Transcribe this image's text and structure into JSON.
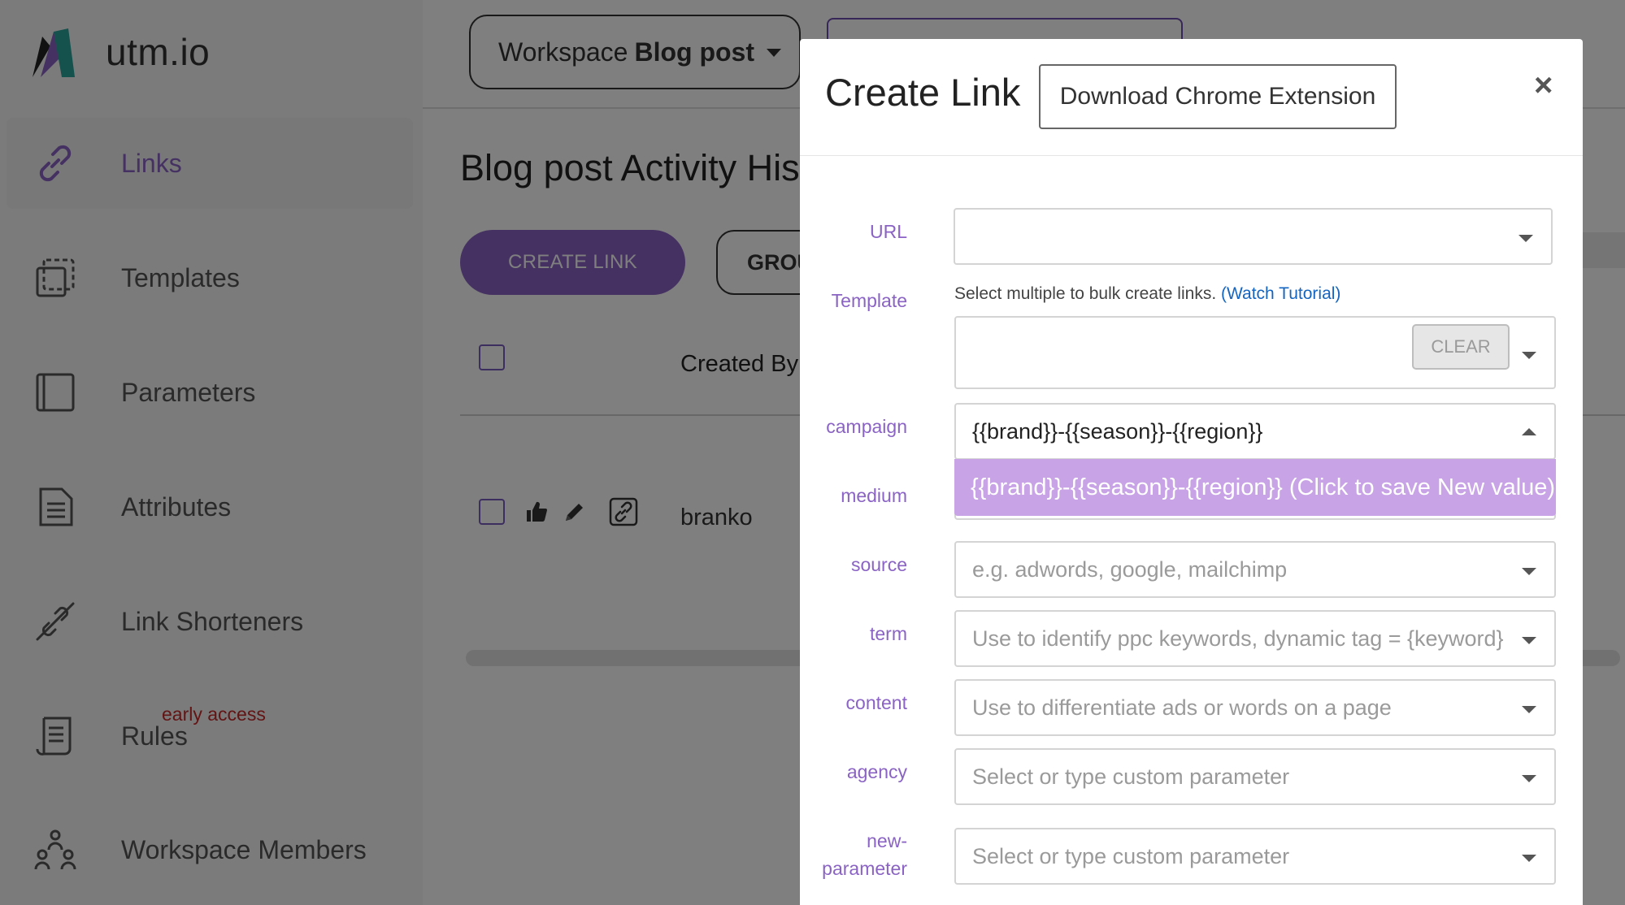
{
  "app": {
    "name": "utm.io"
  },
  "sidebar": {
    "items": [
      {
        "label": "Links",
        "icon": "link-icon",
        "active": true
      },
      {
        "label": "Templates",
        "icon": "templates-icon",
        "active": false
      },
      {
        "label": "Parameters",
        "icon": "parameters-icon",
        "active": false
      },
      {
        "label": "Attributes",
        "icon": "attributes-icon",
        "active": false
      },
      {
        "label": "Link Shorteners",
        "icon": "link-shortener-icon",
        "active": false
      },
      {
        "label": "Rules",
        "icon": "rules-icon",
        "active": false,
        "badge": "early access"
      },
      {
        "label": "Workspace Members",
        "icon": "members-icon",
        "active": false
      }
    ]
  },
  "header": {
    "workspace_prefix": "Workspace",
    "workspace_name": "Blog post"
  },
  "main": {
    "title": "Blog post Activity Hist",
    "create_button": "CREATE LINK",
    "group_button": "GROU",
    "columns": {
      "created_by": "Created By"
    },
    "rows": [
      {
        "created_by": "branko"
      }
    ]
  },
  "modal": {
    "title": "Create Link",
    "extension_button": "Download Chrome Extension",
    "close": "×",
    "fields": {
      "url": {
        "label": "URL",
        "value": "",
        "placeholder": ""
      },
      "template": {
        "label": "Template",
        "help_text": "Select multiple to bulk create links.",
        "help_link": "(Watch Tutorial)",
        "clear": "CLEAR"
      },
      "campaign": {
        "label": "campaign",
        "value": "{{brand}}-{{season}}-{{region}}",
        "suggestion": "{{brand}}-{{season}}-{{region}} (Click to save New value)"
      },
      "medium": {
        "label": "medium"
      },
      "source": {
        "label": "source",
        "placeholder": "e.g. adwords, google, mailchimp"
      },
      "term": {
        "label": "term",
        "placeholder": "Use to identify ppc keywords, dynamic tag = {keyword}"
      },
      "content": {
        "label": "content",
        "placeholder": "Use to differentiate ads or words on a page"
      },
      "agency": {
        "label": "agency",
        "placeholder": "Select or type custom parameter"
      },
      "new_parameter": {
        "label_line1": "new-",
        "label_line2": "parameter",
        "placeholder": "Select or type custom parameter"
      }
    }
  },
  "colors": {
    "accent": "#8A63C4",
    "suggestion_bg": "#c8a3e6",
    "overlay": "rgba(0,0,0,0.5)",
    "link": "#1565c0",
    "badge": "#c62828"
  }
}
